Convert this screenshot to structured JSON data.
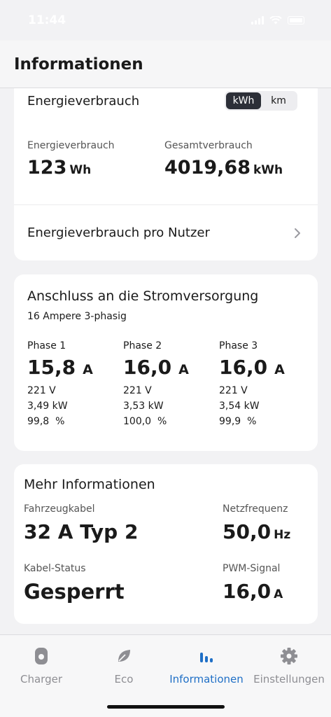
{
  "status_bar": {
    "time": "11:44"
  },
  "header": {
    "title": "Informationen"
  },
  "energy_card": {
    "title": "Energieverbrauch",
    "unit_toggle": {
      "options": [
        "kWh",
        "km"
      ],
      "selected": "kWh"
    },
    "consumption": {
      "label": "Energieverbrauch",
      "value": "123",
      "unit": "Wh"
    },
    "total": {
      "label": "Gesamtverbrauch",
      "value": "4019,68",
      "unit": "kWh"
    },
    "per_user_link": "Energieverbrauch pro Nutzer"
  },
  "power_card": {
    "title": "Anschluss an die Stromversorgung",
    "subtitle": "16 Ampere 3-phasig",
    "phases": [
      {
        "name": "Phase 1",
        "current": "15,8",
        "unit": "A",
        "voltage": "221 V",
        "power": "3,49 kW",
        "percent": "99,8  %"
      },
      {
        "name": "Phase 2",
        "current": "16,0",
        "unit": "A",
        "voltage": "221 V",
        "power": "3,53 kW",
        "percent": "100,0  %"
      },
      {
        "name": "Phase 3",
        "current": "16,0",
        "unit": "A",
        "voltage": "221 V",
        "power": "3,54 kW",
        "percent": "99,9  %"
      }
    ]
  },
  "more_card": {
    "title": "Mehr Informationen",
    "cable": {
      "label": "Fahrzeugkabel",
      "value": "32 A Typ 2"
    },
    "frequency": {
      "label": "Netzfrequenz",
      "value": "50,0",
      "unit": "Hz"
    },
    "cable_status": {
      "label": "Kabel-Status",
      "value": "Gesperrt"
    },
    "pwm": {
      "label": "PWM-Signal",
      "value": "16,0",
      "unit": "A"
    }
  },
  "tabbar": {
    "tabs": [
      {
        "label": "Charger",
        "icon": "charger-icon"
      },
      {
        "label": "Eco",
        "icon": "leaf-icon"
      },
      {
        "label": "Informationen",
        "icon": "bar-chart-icon",
        "active": true
      },
      {
        "label": "Einstellungen",
        "icon": "gear-icon"
      }
    ]
  },
  "colors": {
    "accent": "#1f6fc6",
    "inactive": "#8e8e93",
    "toggle_active": "#2c2f38"
  }
}
